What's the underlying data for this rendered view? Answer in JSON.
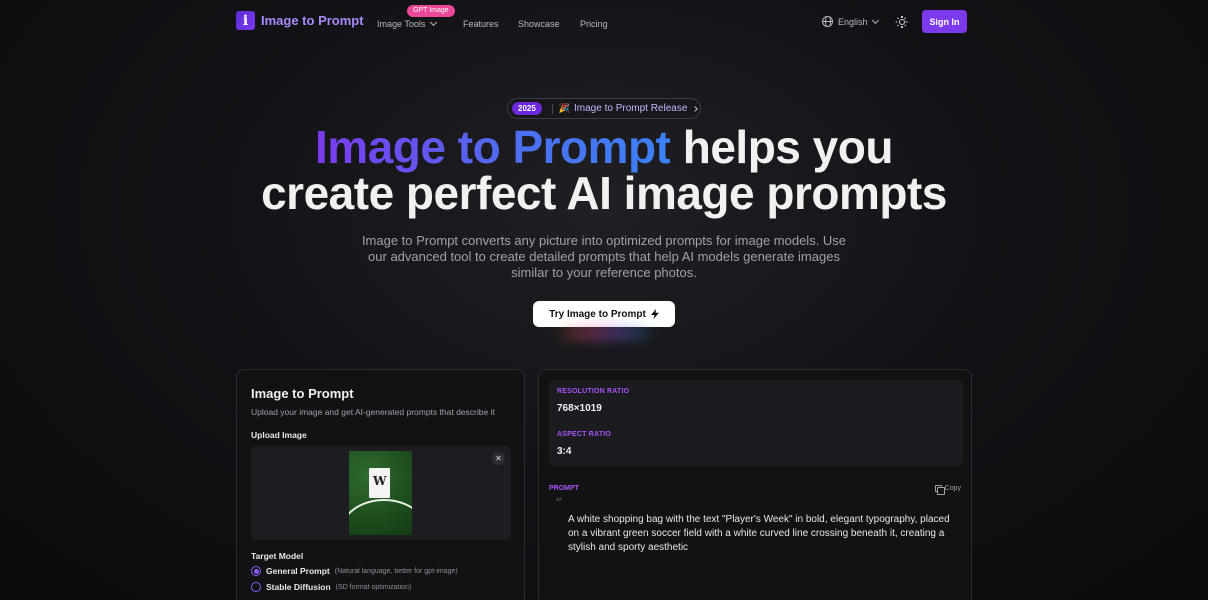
{
  "nav": {
    "brand_letter": "i",
    "brand_name": "Image to Prompt",
    "tools_label": "Image Tools",
    "tools_badge": "GPT Image",
    "features": "Features",
    "showcase": "Showcase",
    "pricing": "Pricing",
    "language": "English",
    "sign_in": "Sign In"
  },
  "hero": {
    "release_year": "2025",
    "release_text": "Image to Prompt Release",
    "headline_accent": "Image to Prompt",
    "headline_rest_1": " helps you",
    "headline_line_2": "create perfect AI image prompts",
    "subtext": "Image to Prompt converts any picture into optimized prompts for image models. Use our advanced tool to create detailed prompts that help AI models generate images similar to your reference photos.",
    "cta": "Try Image to Prompt"
  },
  "tool": {
    "title": "Image to Prompt",
    "description": "Upload your image and get AI-generated prompts that describe it",
    "upload_label": "Upload Image",
    "target_model_label": "Target Model",
    "models": [
      {
        "name": "General Prompt",
        "note": "(Natural language, better for gpt-image)",
        "selected": true
      },
      {
        "name": "Stable Diffusion",
        "note": "(SD format optimization)",
        "selected": false
      }
    ]
  },
  "result": {
    "resolution_label": "RESOLUTION RATIO",
    "resolution_value": "768×1019",
    "aspect_label": "ASPECT RATIO",
    "aspect_value": "3:4",
    "prompt_label": "PROMPT",
    "copy_label": "Copy",
    "prompt_text": "A white shopping bag with the text \"Player's Week\" in bold, elegant typography, placed on a vibrant green soccer field with a white curved line crossing beneath it, creating a stylish and sporty aesthetic"
  },
  "colors": {
    "accent": "#7c3aed",
    "badge": "#ec4899",
    "label_purple": "#a855f7"
  }
}
